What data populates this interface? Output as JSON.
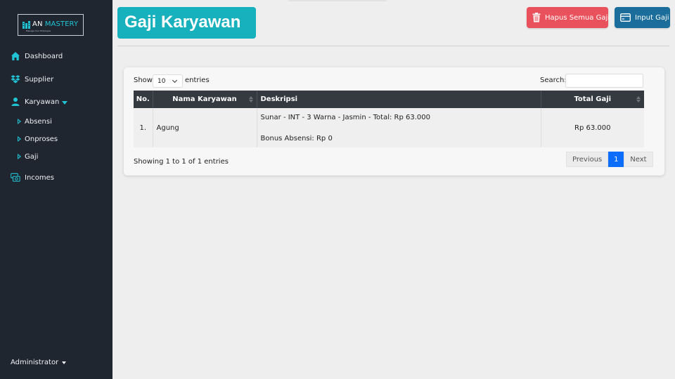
{
  "brand": {
    "logo_prefix": "AN",
    "logo_accent": "MASTERY",
    "tagline": "Manage Your Employee"
  },
  "sidebar": {
    "items": [
      {
        "label": "Dashboard",
        "icon": "house-icon"
      },
      {
        "label": "Supplier",
        "icon": "dropbox-icon"
      },
      {
        "label": "Karyawan",
        "icon": "person-icon"
      },
      {
        "label": "Incomes",
        "icon": "cash-stack-icon"
      }
    ],
    "subitems": [
      {
        "label": "Absensi"
      },
      {
        "label": "Onproses"
      },
      {
        "label": "Gaji"
      }
    ],
    "user": "Administrator"
  },
  "page": {
    "title": "Gaji Karyawan",
    "btn_delete_all": "Hapus Semua Gaji",
    "btn_input": "Input Gaji"
  },
  "table_controls": {
    "show": "Show",
    "page_size": "10",
    "entries": "entries",
    "search": "Search:"
  },
  "table": {
    "headers": [
      "No.",
      "Nama Karyawan",
      "Deskripsi",
      "Total Gaji"
    ],
    "rows": [
      {
        "no": "1.",
        "nama": "Agung",
        "desc_line1": "Sunar - INT - 3 Warna - Jasmin - Total: Rp 63.000",
        "desc_line2": "Bonus Absensi: Rp 0",
        "total": "Rp 63.000"
      }
    ]
  },
  "footer": {
    "info": "Showing 1 to 1 of 1 entries",
    "previous": "Previous",
    "current_page": "1",
    "next": "Next"
  },
  "colors": {
    "sidebar_bg": "#1f2630",
    "accent": "#21c4d4",
    "title_bg": "#17b0bd",
    "danger": "#e9525c",
    "primary": "#1b6d9b",
    "page_active": "#0d6efd"
  }
}
